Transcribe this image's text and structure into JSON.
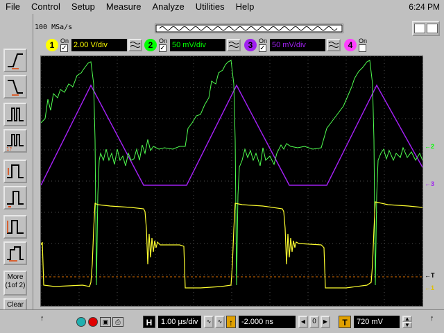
{
  "menu": {
    "items": [
      {
        "label": "File",
        "key": "F"
      },
      {
        "label": "Control",
        "key": "C"
      },
      {
        "label": "Setup",
        "key": "S"
      },
      {
        "label": "Measure",
        "key": "M"
      },
      {
        "label": "Analyze",
        "key": "A"
      },
      {
        "label": "Utilities",
        "key": "U"
      },
      {
        "label": "Help",
        "key": "H"
      }
    ],
    "clock": "6:24 PM"
  },
  "toolbar": {
    "sample_rate": "100 MSa/s"
  },
  "channels": [
    {
      "num": "1",
      "on_label": "On",
      "checked": "✓",
      "scale": "2.00 V/div",
      "color": "#ffff00"
    },
    {
      "num": "2",
      "on_label": "On",
      "checked": "✓",
      "scale": "50 mV/div",
      "color": "#00ff00"
    },
    {
      "num": "3",
      "on_label": "On",
      "checked": "✓",
      "scale": "50 mV/div",
      "color": "#a020f0"
    },
    {
      "num": "4",
      "on_label": "On",
      "checked": "",
      "scale": "",
      "color": "#ff40ff"
    }
  ],
  "side": {
    "more_label": "More\n(1of 2)",
    "clear_label": "Clear\nAll"
  },
  "markers": {
    "ch2": "2",
    "ch3": "3",
    "trig": "T",
    "ch1": "1"
  },
  "bottom": {
    "h_label": "H",
    "timebase": "1.00 µs/div",
    "delay": "-2.000 ns",
    "delay_zero": "0",
    "t_label": "T",
    "trig_level": "720 mV"
  }
}
